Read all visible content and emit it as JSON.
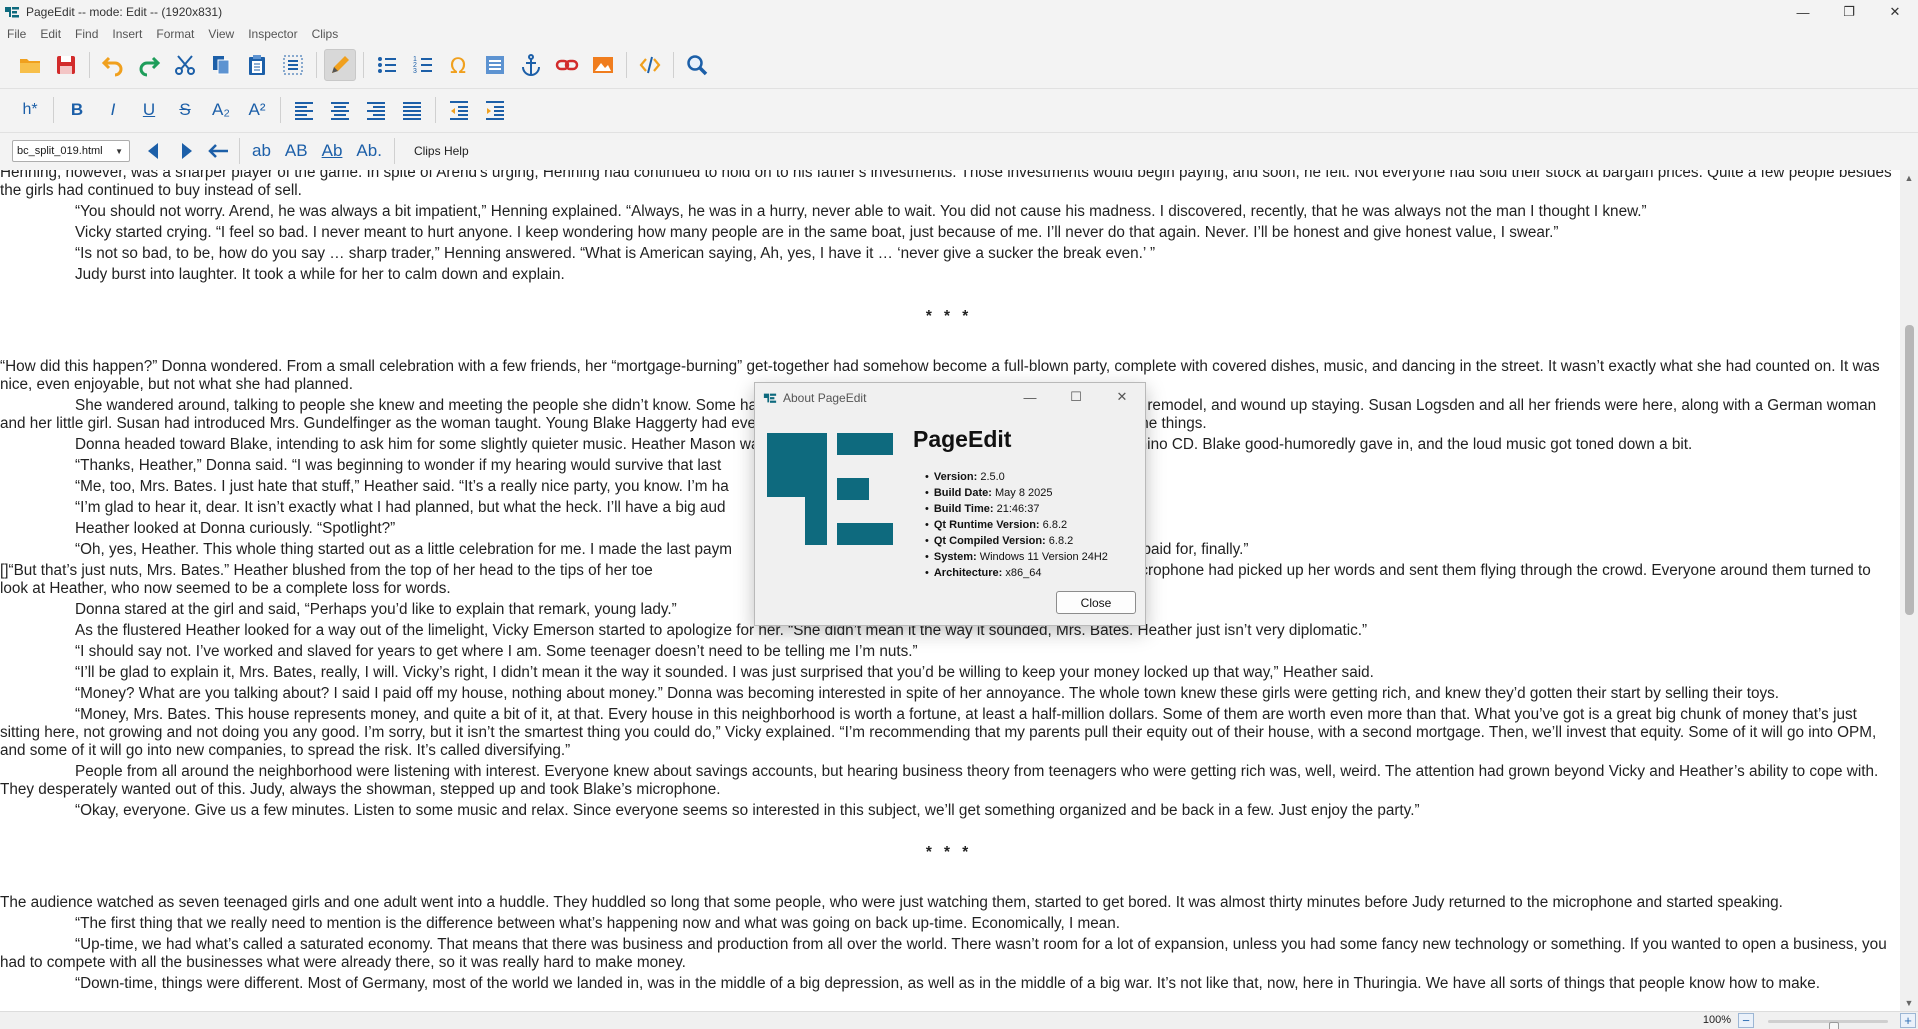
{
  "window": {
    "title": "PageEdit -- mode: Edit -- (1920x831)",
    "minimize": "—",
    "maximize": "❐",
    "close": "✕"
  },
  "menu": [
    "File",
    "Edit",
    "Find",
    "Insert",
    "Format",
    "View",
    "Inspector",
    "Clips"
  ],
  "toolbar2": {
    "heading": "h*",
    "bold": "B",
    "italic": "I",
    "underline": "U",
    "strike": "S",
    "subscript": "A₂",
    "superscript": "A²"
  },
  "toolbar3": {
    "file": "bc_split_019.html",
    "clip1": "ab",
    "clip2": "AB",
    "clip3": "Ab",
    "clip4": "Ab.",
    "clips_help": "Clips Help"
  },
  "document": {
    "p01": "Henning, however, was a sharper player of the game. In spite of Arend's urging, Henning had continued to hold on to his father's investments. Those investments would begin paying, and soon, he felt. Not everyone had sold their stock at bargain prices. Quite a few people besides the girls had continued to buy instead of sell.",
    "p02": "“You should not worry. Arend, he was always a bit impatient,” Henning explained. “Always, he was in a hurry, never able to wait. You did not cause his madness. I discovered, recently, that he was always not the man I thought I knew.”",
    "p03": "Vicky started crying. “I feel so bad. I never meant to hurt anyone. I keep wondering how many people are in the same boat, just because of me. I’ll never do that again. Never. I’ll be honest and give honest value, I swear.”",
    "p04": "“Is not so bad, to be, how do you say … sharp trader,” Henning answered. “What is American saying, Ah, yes, I have it … ‘never give a sucker the break even.’ ”",
    "p05": "Judy burst into laughter. It took a while for her to calm down and explain.",
    "stars1": "* * *",
    "p06": "“How did this happen?” Donna wondered. From a small celebration with a few friends, her “mortgage-burning” get-together had somehow become a full-blown party, complete with covered dishes, music, and dancing in the street. It wasn’t exactly what she had counted on. It was nice, even enjoyable, but not what she had planned.",
    "p07": "She wandered around, talking to people she knew and meeting the people she didn’t know. Some had come ostensibly to check out the garage she wanted to remodel, and wound up staying. Susan Logsden and all her friends were here, along with a German woman and her little girl. Susan had introduced Mrs. Gundelfinger as the woman taught. Young Blake Haggerty had even set himself up as a DJ, with one of those silly microphone things.",
    "p08": "Donna headed toward Blake, intending to ask him for some slightly quieter music. Heather Mason was there, pleading with Blake to play her favorite Fats Domino CD. Blake good-humoredly gave in, and the loud music got toned down a bit.",
    "p09": "“Thanks, Heather,” Donna said. “I was beginning to wonder if my hearing would survive that last",
    "p10": "“Me, too, Mrs. Bates. I just hate that stuff,” Heather said. “It’s a really nice party, you know. I’m ha",
    "p11": "“I’m glad to hear it, dear. It isn’t exactly what I had planned, but what the heck. I’ll have a big aud",
    "p12": "Heather looked at Donna curiously. “Spotlight?”",
    "p13": "“Oh, yes, Heather. This whole thing started out as a little celebration for me. I made the last paym                                                                                          e is paid for, finally.”",
    "p14": "[]“But that’s just nuts, Mrs. Bates.” Heather blushed from the top of her head to the tips of her toe                                                                                          usic, Blake’s microphone had picked up her words and sent them flying through the crowd. Everyone around them turned to look at Heather, who now seemed to be a complete loss for words.",
    "p15": "Donna stared at the girl and said, “Perhaps you’d like to explain that remark, young lady.”",
    "p16": "As the flustered Heather looked for a way out of the limelight, Vicky Emerson started to apologize for her. “She didn’t mean it the way it sounded, Mrs. Bates. Heather just isn’t very diplomatic.”",
    "p17": "“I should say not. I’ve worked and slaved for years to get where I am. Some teenager doesn’t need to be telling me I’m nuts.”",
    "p18": "“I’ll be glad to explain it, Mrs. Bates, really, I will. Vicky’s right, I didn’t mean it the way it sounded. I was just surprised that you’d be willing to keep your money locked up that way,” Heather said.",
    "p19": "“Money? What are you talking about? I said I paid off my house, nothing about money.” Donna was becoming interested in spite of her annoyance. The whole town knew these girls were getting rich, and knew they’d gotten their start by selling their toys.",
    "p20": "“Money, Mrs. Bates. This house represents money, and quite a bit of it, at that. Every house in this neighborhood is worth a fortune, at least a half-million dollars. Some of them are worth even more than that. What you’ve got is a great big chunk of money that’s just sitting here, not growing and not doing you any good. I’m sorry, but it isn’t the smartest thing you could do,” Vicky explained. “I’m recommending that my parents pull their equity out of their house, with a second mortgage. Then, we’ll invest that equity. Some of it will go into OPM, and some of it will go into new companies, to spread the risk. It’s called diversifying.”",
    "p21": "People from all around the neighborhood were listening with interest. Everyone knew about savings accounts, but hearing business theory from teenagers who were getting rich was, well, weird. The attention had grown beyond Vicky and Heather’s ability to cope with. They desperately wanted out of this. Judy, always the showman, stepped up and took Blake’s microphone.",
    "p22": "“Okay, everyone. Give us a few minutes. Listen to some music and relax. Since everyone seems so interested in this subject, we’ll get something organized and be back in a few. Just enjoy the party.”",
    "stars2": "* * *",
    "p23": "The audience watched as seven teenaged girls and one adult went into a huddle. They huddled so long that some people, who were just watching them, started to get bored. It was almost thirty minutes before Judy returned to the microphone and started speaking.",
    "p24": "“The first thing that we really need to mention is the difference between what’s happening now and what was going on back up-time. Economically, I mean.",
    "p25": "“Up-time, we had what’s called a saturated economy. That means that there was business and production from all over the world. There wasn’t room for a lot of expansion, unless you had some fancy new technology or something. If you wanted to open a business, you had to compete with all the businesses what were already there, so it was really hard to make money.",
    "p26": "“Down-time, things were different. Most of Germany, most of the world we landed in, was in the middle of a big depression, as well as in the middle of a big war. It’s not like that, now, here in Thuringia. We have all sorts of things that people know how to make."
  },
  "status": {
    "zoom": "100%",
    "zoom_level": 0.55,
    "minus": "−",
    "plus": "+"
  },
  "about": {
    "title": "About PageEdit",
    "app_name": "PageEdit",
    "info": [
      {
        "label": "Version:",
        "value": "2.5.0"
      },
      {
        "label": "Build Date:",
        "value": "May 8 2025"
      },
      {
        "label": "Build Time:",
        "value": "21:46:37"
      },
      {
        "label": "Qt Runtime Version:",
        "value": "6.8.2"
      },
      {
        "label": "Qt Compiled Version:",
        "value": "6.8.2"
      },
      {
        "label": "System:",
        "value": "Windows 11 Version 24H2"
      },
      {
        "label": "Architecture:",
        "value": "x86_64"
      }
    ],
    "close_label": "Close",
    "brand_color": "#0e6a7e"
  },
  "colors": {
    "icon_blue": "#1c5fa8",
    "icon_orange": "#f0a01e",
    "icon_red": "#d22b2b",
    "icon_green": "#1e9d5a",
    "spell_underline": "#dd2222"
  }
}
